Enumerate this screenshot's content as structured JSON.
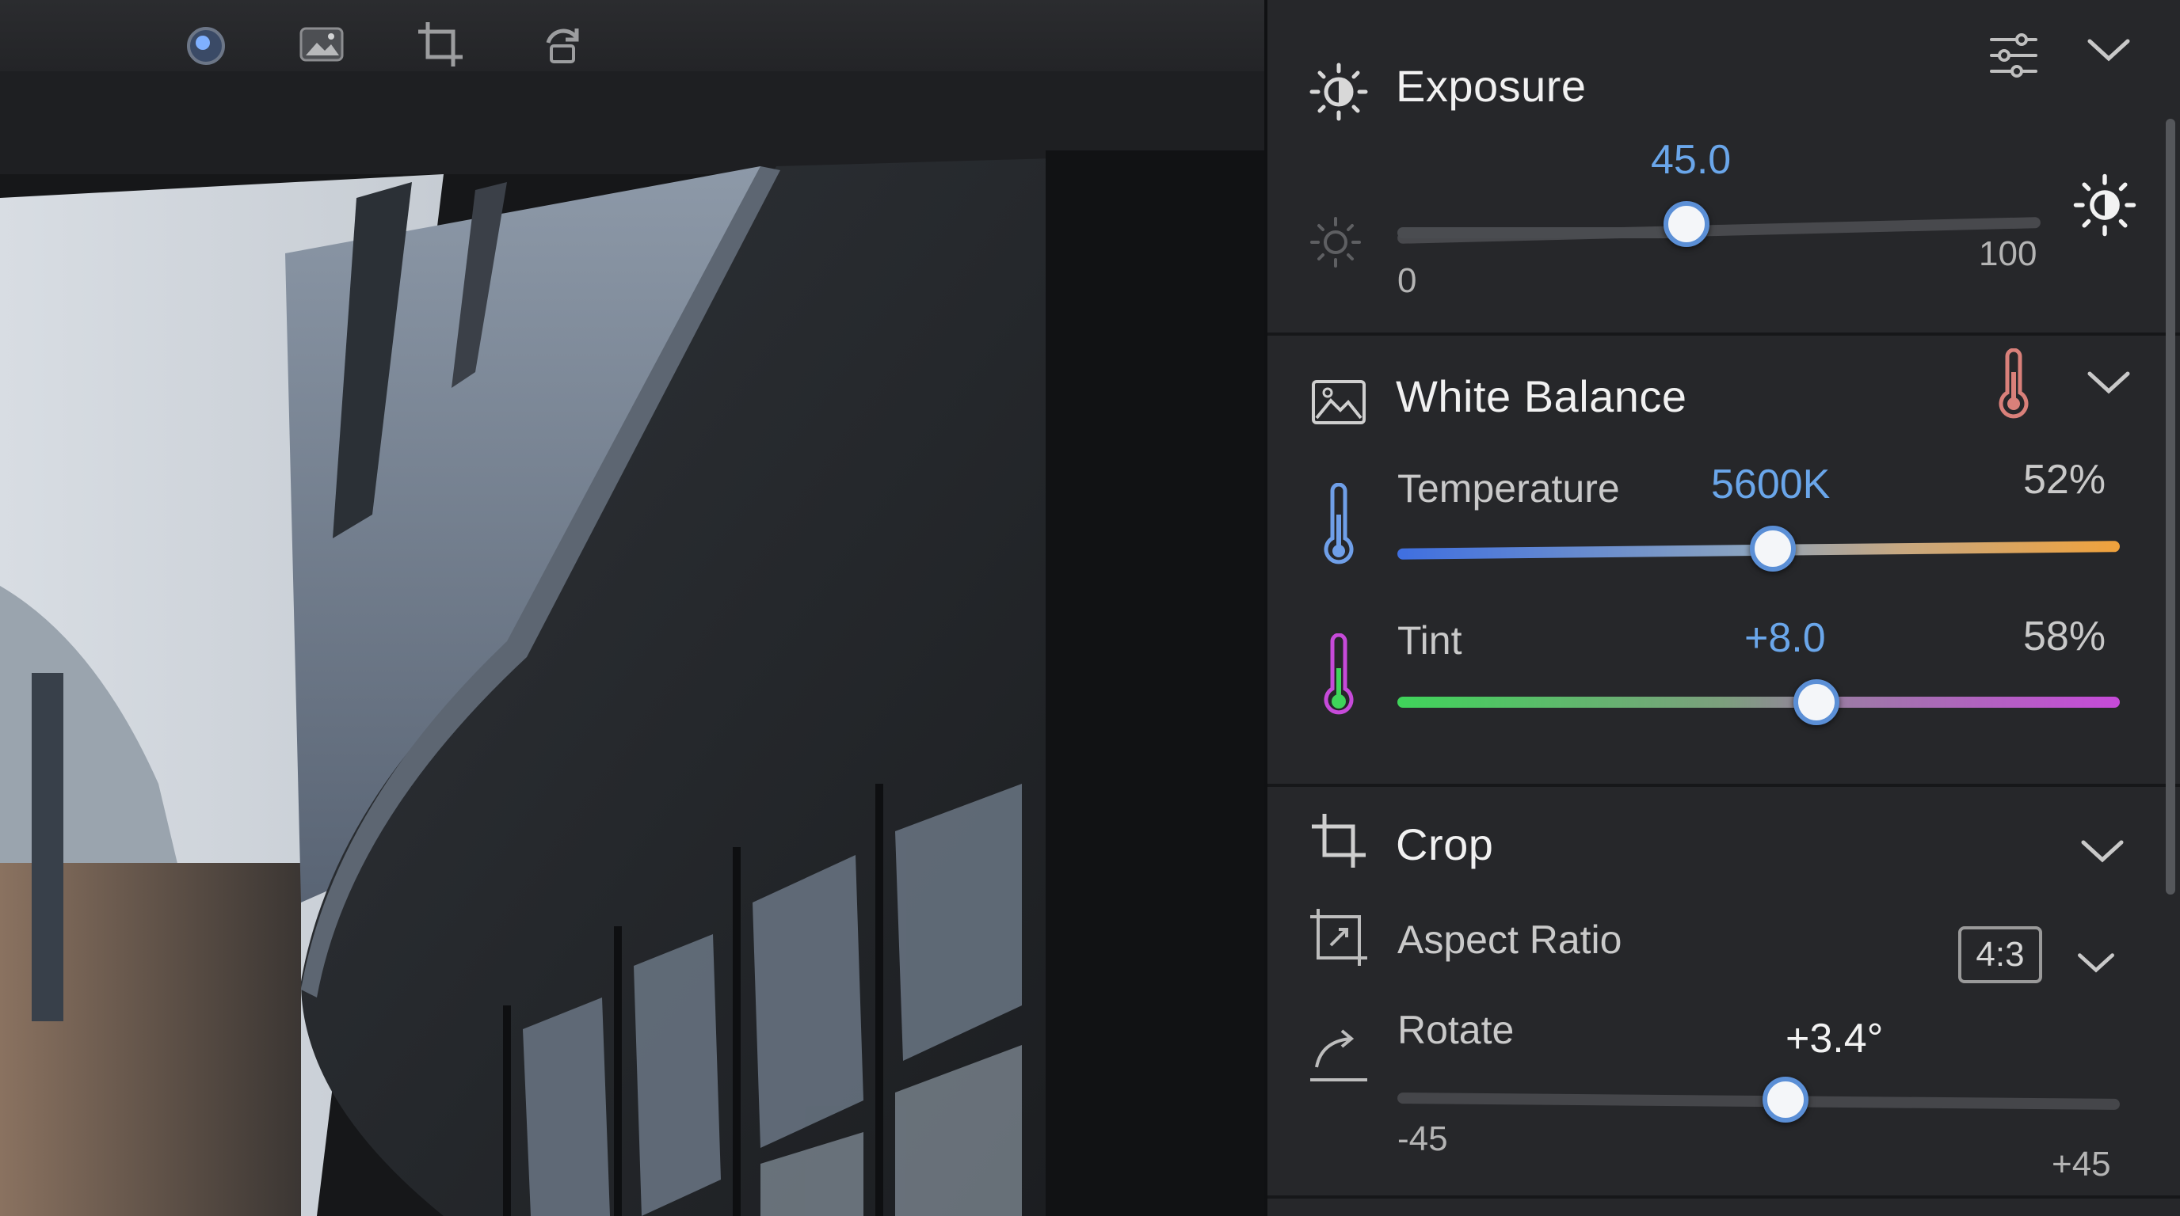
{
  "toolbar": {
    "items": [
      {
        "icon": "lens-icon"
      },
      {
        "icon": "image-icon"
      },
      {
        "icon": "crop-icon"
      },
      {
        "icon": "rotate-icon"
      }
    ]
  },
  "exposure": {
    "title": "Exposure",
    "value": "45.0",
    "min_label": "0",
    "max_label": "100",
    "level": 45.0,
    "accent": "#6aa6ea"
  },
  "white_balance": {
    "title": "White Balance",
    "temperature": {
      "label": "Temperature",
      "value": "5600K",
      "percent": "52%",
      "level": 52
    },
    "tint": {
      "label": "Tint",
      "value": "+8.0",
      "percent": "58%",
      "level": 58
    }
  },
  "crop": {
    "title": "Crop",
    "aspect_ratio": {
      "label": "Aspect Ratio",
      "value": "4:3"
    },
    "rotate": {
      "label": "Rotate",
      "value": "+3.4°",
      "min_label": "-45",
      "max_label": "+45",
      "level_degrees": 3.4,
      "range": [
        -45,
        45
      ]
    }
  },
  "colors": {
    "accent_blue": "#6aa6ea",
    "temp_cold": "#3f6fe0",
    "temp_warm": "#f0a23c",
    "tint_green": "#3fd45a",
    "tint_magenta": "#c64ad9"
  }
}
